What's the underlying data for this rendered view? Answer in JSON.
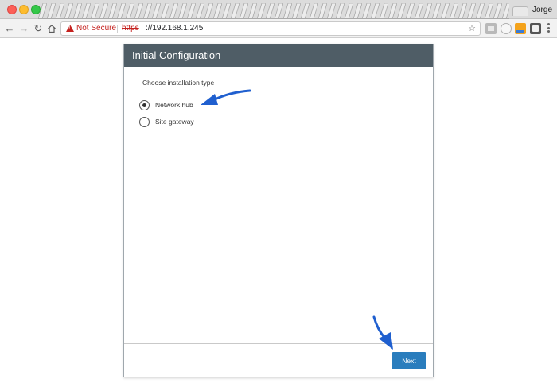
{
  "browser": {
    "user_name": "Jorge",
    "security_label": "Not Secure",
    "url_scheme": "https",
    "url_rest": "://192.168.1.245",
    "colors": {
      "insecure": "#c5221f"
    }
  },
  "dialog": {
    "title": "Initial Configuration",
    "subtitle": "Choose installation type",
    "options": [
      {
        "label": "Network hub",
        "selected": true
      },
      {
        "label": "Site gateway",
        "selected": false
      }
    ],
    "next_label": "Next",
    "colors": {
      "header_bg": "#4f5d66",
      "button_bg": "#2a7dbd",
      "annotation_arrow": "#1f5fcf"
    }
  }
}
